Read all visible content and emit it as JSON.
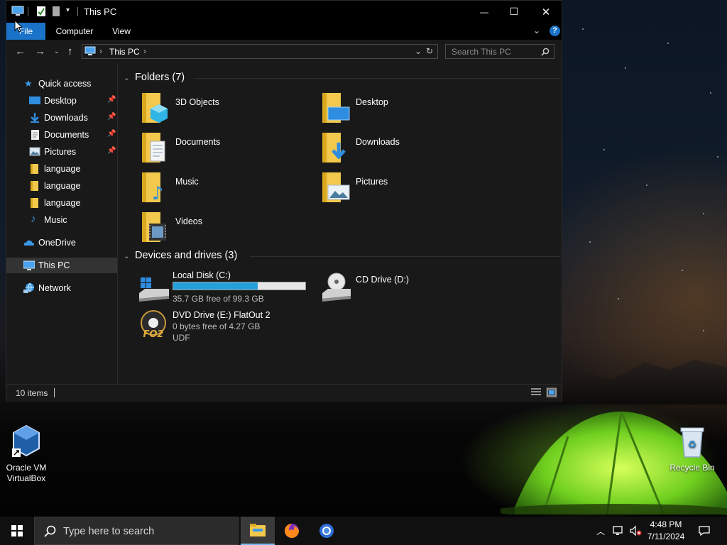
{
  "window": {
    "title": "This PC",
    "controls": {
      "minimize": "—",
      "maximize": "☐",
      "close": "✕"
    }
  },
  "ribbon": {
    "tabs": [
      "File",
      "Computer",
      "View"
    ],
    "help": "?"
  },
  "address": {
    "location": "This PC",
    "search_placeholder": "Search This PC"
  },
  "nav": {
    "quick_access": "Quick access",
    "items": [
      {
        "label": "Desktop",
        "icon": "desktop-icon",
        "pinned": true
      },
      {
        "label": "Downloads",
        "icon": "downloads-icon",
        "pinned": true
      },
      {
        "label": "Documents",
        "icon": "documents-icon",
        "pinned": true
      },
      {
        "label": "Pictures",
        "icon": "pictures-icon",
        "pinned": true
      },
      {
        "label": "language",
        "icon": "folder-icon",
        "pinned": false
      },
      {
        "label": "language",
        "icon": "folder-icon",
        "pinned": false
      },
      {
        "label": "language",
        "icon": "folder-icon",
        "pinned": false
      },
      {
        "label": "Music",
        "icon": "music-icon",
        "pinned": false
      }
    ],
    "onedrive": "OneDrive",
    "this_pc": "This PC",
    "network": "Network"
  },
  "folders": {
    "header": "Folders (7)",
    "items": [
      {
        "label": "3D Objects",
        "icon": "3d-objects-icon"
      },
      {
        "label": "Desktop",
        "icon": "desktop-folder-icon"
      },
      {
        "label": "Documents",
        "icon": "documents-folder-icon"
      },
      {
        "label": "Downloads",
        "icon": "downloads-folder-icon"
      },
      {
        "label": "Music",
        "icon": "music-folder-icon"
      },
      {
        "label": "Pictures",
        "icon": "pictures-folder-icon"
      },
      {
        "label": "Videos",
        "icon": "videos-folder-icon"
      }
    ]
  },
  "drives": {
    "header": "Devices and drives (3)",
    "items": [
      {
        "name": "Local Disk (C:)",
        "free": "35.7 GB free of 99.3 GB",
        "used_fraction": 0.64,
        "icon": "local-disk-icon"
      },
      {
        "name": "CD Drive (D:)",
        "icon": "cd-drive-icon"
      },
      {
        "name": "DVD Drive (E:) FlatOut 2",
        "free": "0 bytes free of 4.27 GB",
        "fs": "UDF",
        "icon": "flatout2-disc-icon"
      }
    ]
  },
  "status": {
    "count": "10 items"
  },
  "desktop": {
    "icons": [
      {
        "label": "Oracle VM VirtualBox",
        "icon": "virtualbox-icon"
      },
      {
        "label": "Recycle Bin",
        "icon": "recycle-bin-icon"
      }
    ]
  },
  "taskbar": {
    "search_placeholder": "Type here to search",
    "time": "4:48 PM",
    "date": "7/11/2024"
  },
  "colors": {
    "accent": "#1a73c9",
    "bar_fill": "#26a0da",
    "folder": "#f2c94c"
  }
}
